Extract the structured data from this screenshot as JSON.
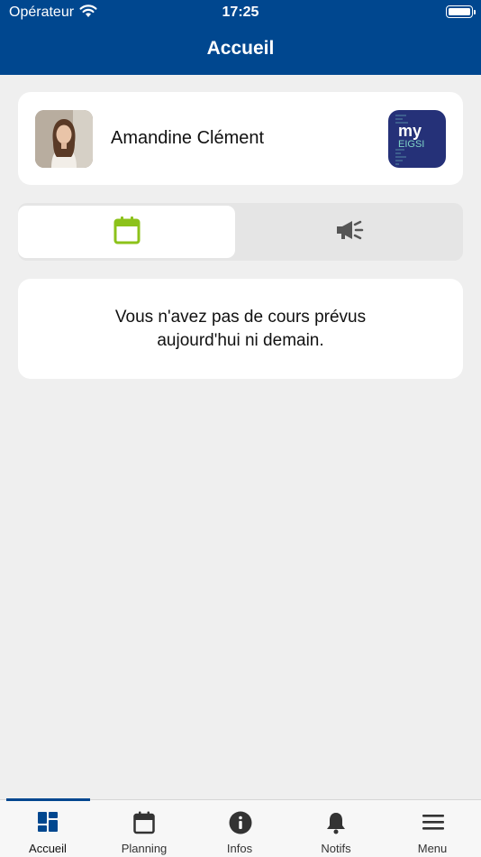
{
  "status_bar": {
    "carrier": "Opérateur",
    "time": "17:25"
  },
  "header": {
    "title": "Accueil"
  },
  "profile": {
    "name": "Amandine Clément",
    "logo_text": {
      "line1": "my",
      "line2": "EIGSI"
    }
  },
  "tabs": [
    {
      "icon": "calendar-icon",
      "selected": true
    },
    {
      "icon": "megaphone-icon",
      "selected": false
    }
  ],
  "message": "Vous n'avez pas de cours prévus aujourd'hui ni demain.",
  "tabbar": {
    "items": [
      {
        "label": "Accueil",
        "icon": "dashboard-icon",
        "active": true
      },
      {
        "label": "Planning",
        "icon": "calendar-icon",
        "active": false
      },
      {
        "label": "Infos",
        "icon": "info-icon",
        "active": false
      },
      {
        "label": "Notifs",
        "icon": "bell-icon",
        "active": false
      },
      {
        "label": "Menu",
        "icon": "hamburger-menu-icon",
        "active": false
      }
    ]
  },
  "colors": {
    "header": "#00478f",
    "accent_green": "#8cc21a",
    "logo_bg": "#253178",
    "logo_text_accent": "#7fd3c6",
    "background": "#efefef"
  }
}
